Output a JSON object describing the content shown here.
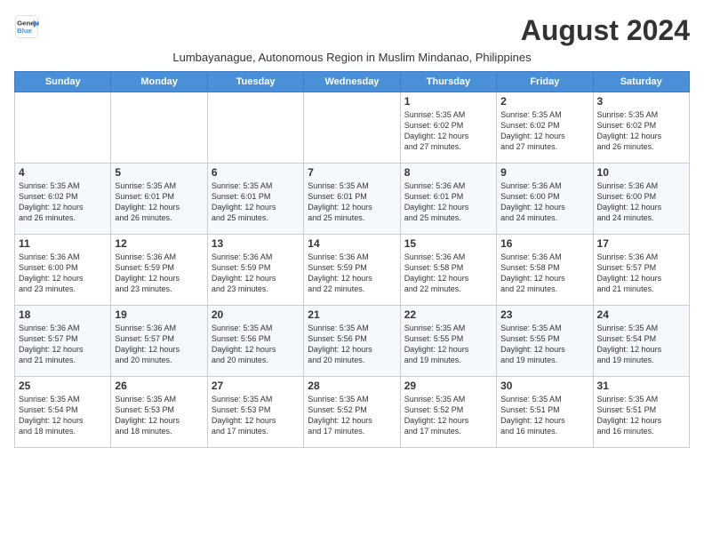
{
  "header": {
    "logo_line1": "General",
    "logo_line2": "Blue",
    "month_title": "August 2024",
    "subtitle": "Lumbayanague, Autonomous Region in Muslim Mindanao, Philippines"
  },
  "weekdays": [
    "Sunday",
    "Monday",
    "Tuesday",
    "Wednesday",
    "Thursday",
    "Friday",
    "Saturday"
  ],
  "weeks": [
    [
      {
        "day": "",
        "info": ""
      },
      {
        "day": "",
        "info": ""
      },
      {
        "day": "",
        "info": ""
      },
      {
        "day": "",
        "info": ""
      },
      {
        "day": "1",
        "info": "Sunrise: 5:35 AM\nSunset: 6:02 PM\nDaylight: 12 hours\nand 27 minutes."
      },
      {
        "day": "2",
        "info": "Sunrise: 5:35 AM\nSunset: 6:02 PM\nDaylight: 12 hours\nand 27 minutes."
      },
      {
        "day": "3",
        "info": "Sunrise: 5:35 AM\nSunset: 6:02 PM\nDaylight: 12 hours\nand 26 minutes."
      }
    ],
    [
      {
        "day": "4",
        "info": "Sunrise: 5:35 AM\nSunset: 6:02 PM\nDaylight: 12 hours\nand 26 minutes."
      },
      {
        "day": "5",
        "info": "Sunrise: 5:35 AM\nSunset: 6:01 PM\nDaylight: 12 hours\nand 26 minutes."
      },
      {
        "day": "6",
        "info": "Sunrise: 5:35 AM\nSunset: 6:01 PM\nDaylight: 12 hours\nand 25 minutes."
      },
      {
        "day": "7",
        "info": "Sunrise: 5:35 AM\nSunset: 6:01 PM\nDaylight: 12 hours\nand 25 minutes."
      },
      {
        "day": "8",
        "info": "Sunrise: 5:36 AM\nSunset: 6:01 PM\nDaylight: 12 hours\nand 25 minutes."
      },
      {
        "day": "9",
        "info": "Sunrise: 5:36 AM\nSunset: 6:00 PM\nDaylight: 12 hours\nand 24 minutes."
      },
      {
        "day": "10",
        "info": "Sunrise: 5:36 AM\nSunset: 6:00 PM\nDaylight: 12 hours\nand 24 minutes."
      }
    ],
    [
      {
        "day": "11",
        "info": "Sunrise: 5:36 AM\nSunset: 6:00 PM\nDaylight: 12 hours\nand 23 minutes."
      },
      {
        "day": "12",
        "info": "Sunrise: 5:36 AM\nSunset: 5:59 PM\nDaylight: 12 hours\nand 23 minutes."
      },
      {
        "day": "13",
        "info": "Sunrise: 5:36 AM\nSunset: 5:59 PM\nDaylight: 12 hours\nand 23 minutes."
      },
      {
        "day": "14",
        "info": "Sunrise: 5:36 AM\nSunset: 5:59 PM\nDaylight: 12 hours\nand 22 minutes."
      },
      {
        "day": "15",
        "info": "Sunrise: 5:36 AM\nSunset: 5:58 PM\nDaylight: 12 hours\nand 22 minutes."
      },
      {
        "day": "16",
        "info": "Sunrise: 5:36 AM\nSunset: 5:58 PM\nDaylight: 12 hours\nand 22 minutes."
      },
      {
        "day": "17",
        "info": "Sunrise: 5:36 AM\nSunset: 5:57 PM\nDaylight: 12 hours\nand 21 minutes."
      }
    ],
    [
      {
        "day": "18",
        "info": "Sunrise: 5:36 AM\nSunset: 5:57 PM\nDaylight: 12 hours\nand 21 minutes."
      },
      {
        "day": "19",
        "info": "Sunrise: 5:36 AM\nSunset: 5:57 PM\nDaylight: 12 hours\nand 20 minutes."
      },
      {
        "day": "20",
        "info": "Sunrise: 5:35 AM\nSunset: 5:56 PM\nDaylight: 12 hours\nand 20 minutes."
      },
      {
        "day": "21",
        "info": "Sunrise: 5:35 AM\nSunset: 5:56 PM\nDaylight: 12 hours\nand 20 minutes."
      },
      {
        "day": "22",
        "info": "Sunrise: 5:35 AM\nSunset: 5:55 PM\nDaylight: 12 hours\nand 19 minutes."
      },
      {
        "day": "23",
        "info": "Sunrise: 5:35 AM\nSunset: 5:55 PM\nDaylight: 12 hours\nand 19 minutes."
      },
      {
        "day": "24",
        "info": "Sunrise: 5:35 AM\nSunset: 5:54 PM\nDaylight: 12 hours\nand 19 minutes."
      }
    ],
    [
      {
        "day": "25",
        "info": "Sunrise: 5:35 AM\nSunset: 5:54 PM\nDaylight: 12 hours\nand 18 minutes."
      },
      {
        "day": "26",
        "info": "Sunrise: 5:35 AM\nSunset: 5:53 PM\nDaylight: 12 hours\nand 18 minutes."
      },
      {
        "day": "27",
        "info": "Sunrise: 5:35 AM\nSunset: 5:53 PM\nDaylight: 12 hours\nand 17 minutes."
      },
      {
        "day": "28",
        "info": "Sunrise: 5:35 AM\nSunset: 5:52 PM\nDaylight: 12 hours\nand 17 minutes."
      },
      {
        "day": "29",
        "info": "Sunrise: 5:35 AM\nSunset: 5:52 PM\nDaylight: 12 hours\nand 17 minutes."
      },
      {
        "day": "30",
        "info": "Sunrise: 5:35 AM\nSunset: 5:51 PM\nDaylight: 12 hours\nand 16 minutes."
      },
      {
        "day": "31",
        "info": "Sunrise: 5:35 AM\nSunset: 5:51 PM\nDaylight: 12 hours\nand 16 minutes."
      }
    ]
  ]
}
